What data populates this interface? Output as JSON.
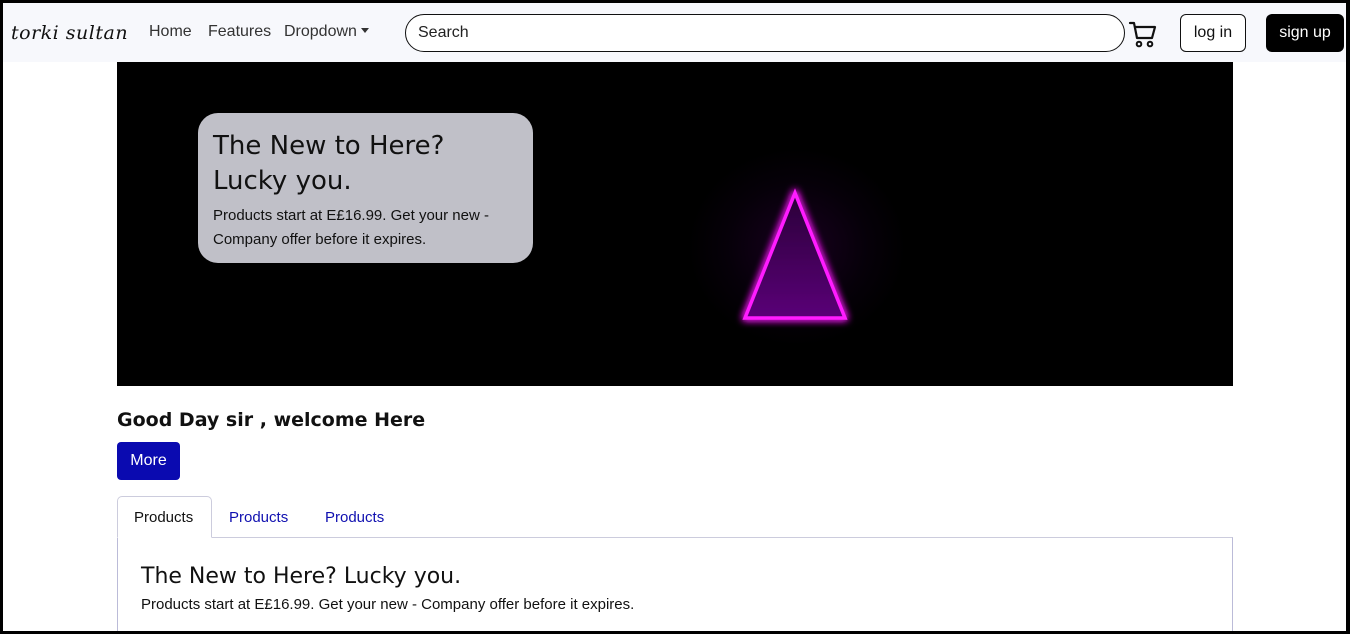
{
  "navbar": {
    "brand": "torki sultan",
    "links": [
      {
        "label": "Home"
      },
      {
        "label": "Features"
      },
      {
        "label": "Dropdown"
      }
    ],
    "search": {
      "placeholder": "Search",
      "value": ""
    },
    "cart_icon": "cart-icon",
    "login_label": "log in",
    "signup_label": "sign up"
  },
  "hero": {
    "title": "The New to Here? Lucky you.",
    "text": "Products start at E£16.99. Get your new - Company offer before it expires.",
    "colors": {
      "background": "#000000",
      "card": "#c0c0c8",
      "triangle": "#ff00ff"
    }
  },
  "welcome": {
    "heading": "Good Day sir , welcome Here",
    "more_label": "More"
  },
  "tabs": {
    "items": [
      {
        "label": "Products",
        "active": true
      },
      {
        "label": "Products",
        "active": false
      },
      {
        "label": "Products",
        "active": false
      }
    ],
    "panel": {
      "title": "The New to Here? Lucky you.",
      "text": "Products start at E£16.99. Get your new - Company offer before it expires."
    }
  },
  "colors": {
    "accent": "#0a0ab0",
    "link": "#1010b0",
    "navbar_bg": "#f7f8fc"
  }
}
